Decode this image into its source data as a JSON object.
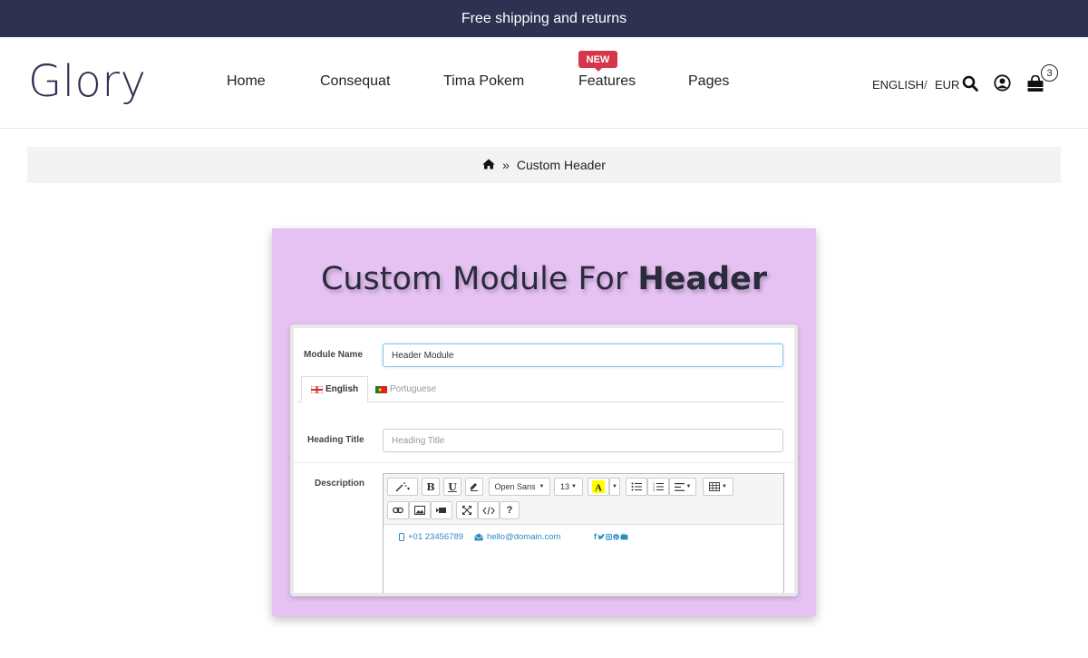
{
  "topbar": {
    "text": "Free shipping and returns"
  },
  "header": {
    "logo": "Glory",
    "nav": [
      {
        "label": "Home"
      },
      {
        "label": "Consequat"
      },
      {
        "label": "Tima Pokem"
      },
      {
        "label": "Features",
        "badge": "NEW"
      },
      {
        "label": "Pages"
      }
    ],
    "language": "ENGLISH",
    "divider": "/",
    "currency": "EUR",
    "cart_count": "3",
    "badge_color": "#d6364b"
  },
  "breadcrumb": {
    "separator": "»",
    "current": "Custom Header"
  },
  "promo": {
    "title_regular": "Custom Module For ",
    "title_bold": "Header",
    "background": "#e6c2f3",
    "form": {
      "module_name_label": "Module Name",
      "module_name_value": "Header Module",
      "tabs": [
        {
          "label": "English"
        },
        {
          "label": "Portuguese"
        }
      ],
      "heading_title_label": "Heading Title",
      "heading_title_placeholder": "Heading Title",
      "description_label": "Description",
      "toolbar": {
        "font": "Open Sans",
        "size": "13",
        "bold": "B",
        "underline": "U",
        "help": "?"
      },
      "content": {
        "phone": "+01 23456789",
        "email": "hello@domain.com"
      }
    }
  }
}
